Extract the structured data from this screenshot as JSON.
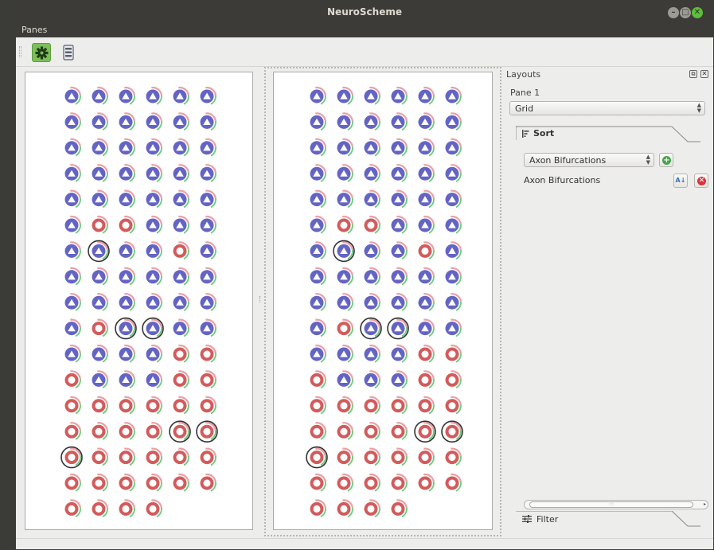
{
  "window": {
    "title": "NeuroScheme"
  },
  "menubar": {
    "items": [
      "Panes"
    ]
  },
  "toolbar": {
    "settings_icon": "gear-icon",
    "layout_icon": "layout-list-icon"
  },
  "panes": [
    {
      "name": "pane-left"
    },
    {
      "name": "pane-right"
    }
  ],
  "neuron_grid": {
    "columns": 6,
    "note_colors": {
      "pyramidal": "#6464c4",
      "interneuron": "#d35b5b",
      "highlight_green": "#6ccc7c",
      "highlight_pink": "#eaa0a6",
      "ring_dark": "#333333"
    },
    "cells": [
      "P",
      "P",
      "P",
      "P",
      "P",
      "P",
      "P",
      "P",
      "P",
      "P",
      "P",
      "P",
      "P",
      "P",
      "P",
      "P",
      "P",
      "P",
      "P",
      "P",
      "P",
      "P",
      "P",
      "P",
      "P",
      "P",
      "P",
      "P",
      "P",
      "P",
      "P",
      "I",
      "I",
      "P",
      "P",
      "P",
      "P",
      "PR",
      "P",
      "P",
      "I",
      "P",
      "P",
      "P",
      "P",
      "P",
      "P",
      "P",
      "P",
      "P",
      "P",
      "P",
      "P",
      "P",
      "P",
      "I",
      "PR",
      "PR",
      "P",
      "P",
      "P",
      "P",
      "P",
      "P",
      "I",
      "I",
      "I",
      "P",
      "P",
      "P",
      "I",
      "I",
      "I",
      "I",
      "I",
      "I",
      "I",
      "I",
      "I",
      "I",
      "I",
      "I",
      "IR",
      "IR",
      "IR",
      "I",
      "I",
      "I",
      "I",
      "I",
      "I",
      "I",
      "I",
      "I",
      "I",
      "I",
      "I",
      "I",
      "I",
      "I"
    ]
  },
  "layouts_dock": {
    "title": "Layouts",
    "pane_label": "Pane 1",
    "layout_value": "Grid",
    "sort_tab": "Sort",
    "sort_select_value": "Axon Bifurcations",
    "sort_entry": "Axon Bifurcations",
    "filter_tab": "Filter",
    "scroll_grip": ":::",
    "float_glyph": "⧉",
    "close_glyph": "✕"
  },
  "colors": {
    "accent_green": "#7cbf5a",
    "titlebar": "#3c3b37",
    "close_button": "#5ebd3c"
  }
}
